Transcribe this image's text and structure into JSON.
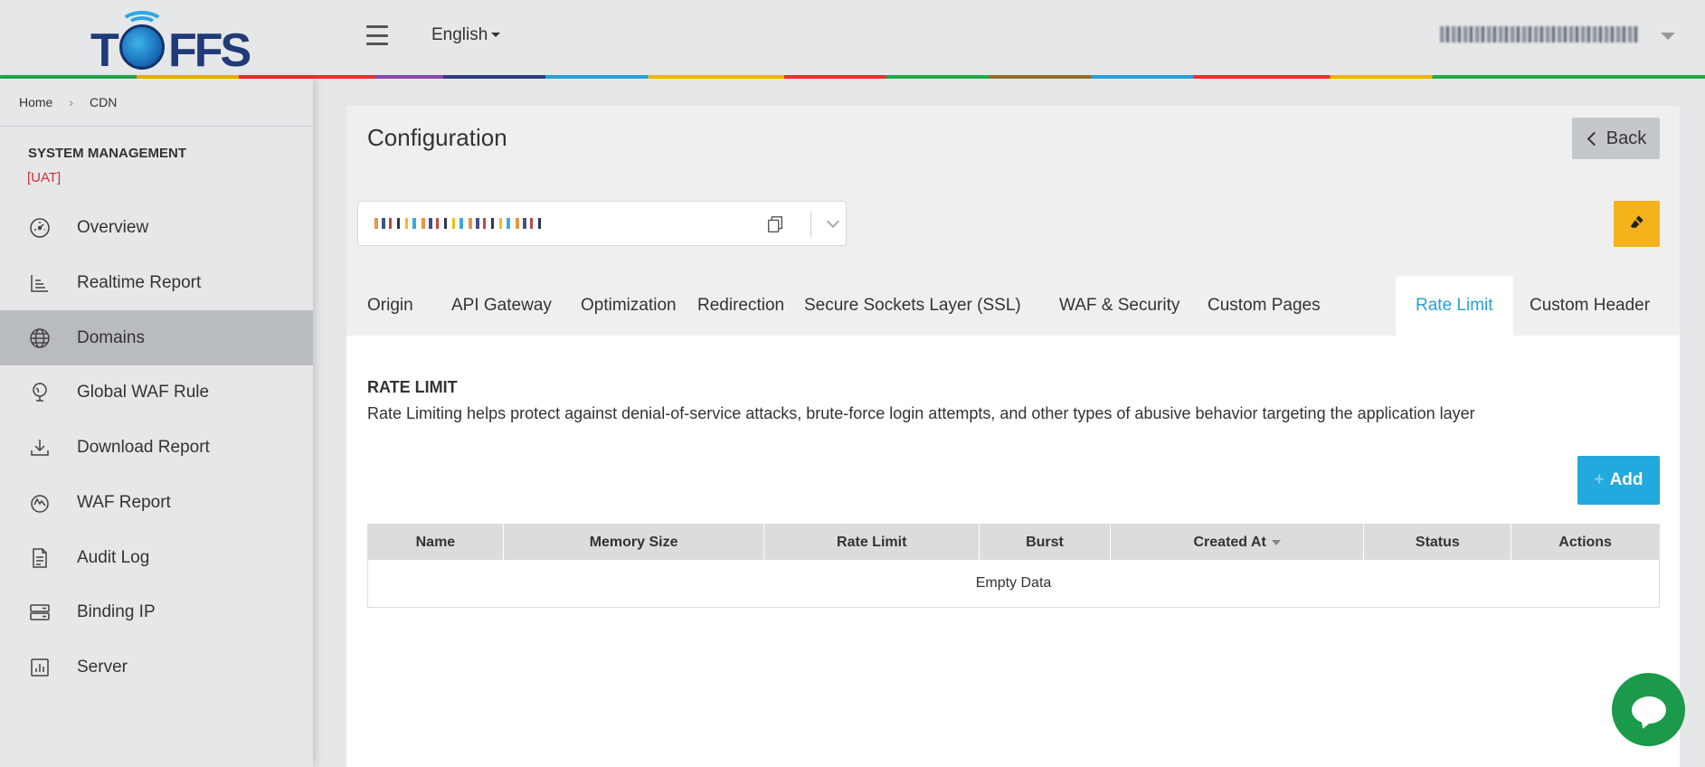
{
  "header": {
    "logo_text": "TOFFS",
    "language": "English",
    "user_email": "developer@toffs.example.com",
    "colors": {
      "brand": "#213a78",
      "accent": "#2a9fd6"
    }
  },
  "breadcrumb": {
    "home": "Home",
    "current": "CDN"
  },
  "sidebar": {
    "section_title": "SYSTEM MANAGEMENT",
    "env_tag": "[UAT]",
    "items": [
      {
        "label": "Overview",
        "icon": "speedometer-icon"
      },
      {
        "label": "Realtime Report",
        "icon": "chart-icon"
      },
      {
        "label": "Domains",
        "icon": "globe-icon",
        "active": true
      },
      {
        "label": "Global WAF Rule",
        "icon": "globe-stand-icon"
      },
      {
        "label": "Download Report",
        "icon": "download-icon"
      },
      {
        "label": "WAF Report",
        "icon": "waf-icon"
      },
      {
        "label": "Audit Log",
        "icon": "document-icon"
      },
      {
        "label": "Binding IP",
        "icon": "server-icon"
      },
      {
        "label": "Server",
        "icon": "bar-chart-icon"
      }
    ]
  },
  "main": {
    "title": "Configuration",
    "back_label": "Back",
    "tabs": [
      {
        "label": "Origin"
      },
      {
        "label": "API Gateway"
      },
      {
        "label": "Optimization"
      },
      {
        "label": "Redirection"
      },
      {
        "label": "Secure Sockets Layer (SSL)"
      },
      {
        "label": "WAF & Security"
      },
      {
        "label": "Custom Pages"
      },
      {
        "label": "Rate Limit",
        "active": true
      },
      {
        "label": "Custom Header"
      }
    ],
    "section_title": "RATE LIMIT",
    "section_desc": "Rate Limiting helps protect against denial-of-service attacks, brute-force login attempts, and other types of abusive behavior targeting the application layer",
    "add_label": "Add",
    "table": {
      "columns": [
        "Name",
        "Memory Size",
        "Rate Limit",
        "Burst",
        "Created At",
        "Status",
        "Actions"
      ],
      "empty_text": "Empty Data"
    }
  }
}
